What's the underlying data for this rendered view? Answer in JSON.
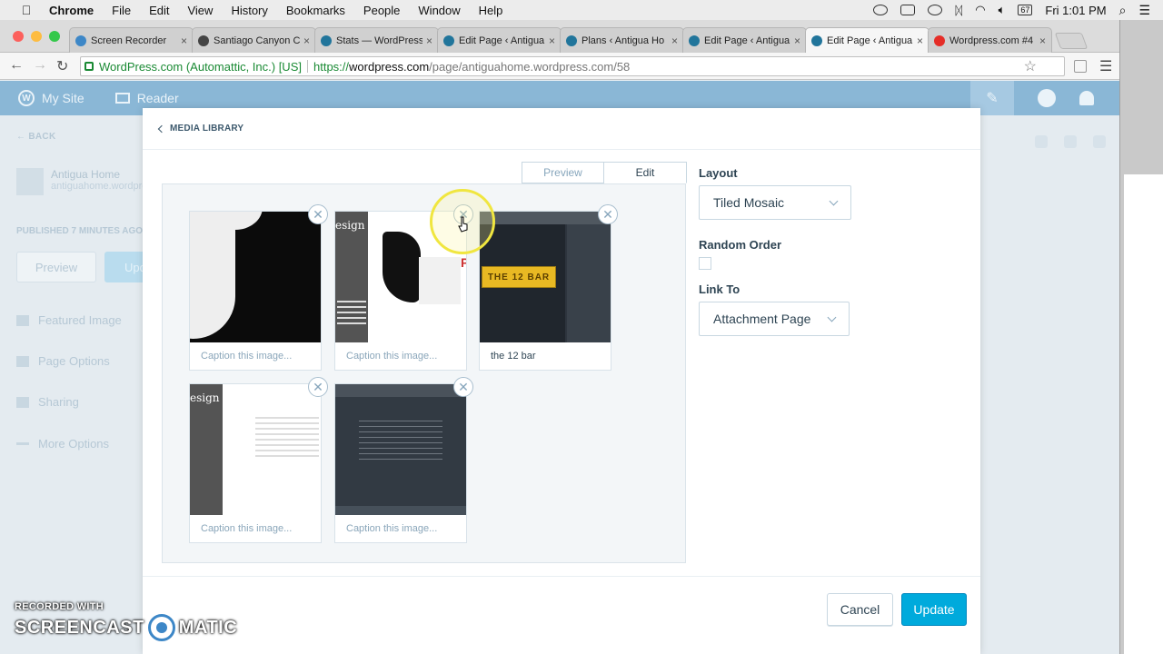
{
  "menubar": {
    "app": "Chrome",
    "items": [
      "File",
      "Edit",
      "View",
      "History",
      "Bookmarks",
      "People",
      "Window",
      "Help"
    ],
    "battery": "67",
    "clock": "Fri 1:01 PM"
  },
  "tabs": [
    {
      "label": "Screen Recorder",
      "icon": "screencast-icon",
      "color": "#3d87c7"
    },
    {
      "label": "Santiago Canyon C",
      "icon": "plane-icon",
      "color": "#444444"
    },
    {
      "label": "Stats — WordPress",
      "icon": "wordpress-icon",
      "color": "#21759b"
    },
    {
      "label": "Edit Page ‹ Antigua",
      "icon": "wordpress-icon",
      "color": "#21759b"
    },
    {
      "label": "Plans ‹ Antigua Ho",
      "icon": "wordpress-icon",
      "color": "#21759b"
    },
    {
      "label": "Edit Page ‹ Antigua",
      "icon": "wordpress-icon",
      "color": "#21759b"
    },
    {
      "label": "Edit Page ‹ Antigua",
      "icon": "wordpress-icon",
      "color": "#21759b",
      "active": true
    },
    {
      "label": "Wordpress.com #4",
      "icon": "youtube-icon",
      "color": "#e52d27"
    }
  ],
  "address": {
    "ev_label": "WordPress.com (Automattic, Inc.) [US]",
    "protocol": "https://",
    "host": "wordpress.com",
    "path": "/page/antiguahome.wordpress.com/58"
  },
  "masterbar": {
    "my_site": "My Site",
    "reader": "Reader"
  },
  "background_sidebar": {
    "back": "BACK",
    "site_name": "Antigua Home",
    "site_url": "antiguahome.wordpress.com",
    "status": "PUBLISHED 7 MINUTES AGO",
    "preview": "Preview",
    "update": "Update",
    "nav": [
      "Featured Image",
      "Page Options",
      "Sharing",
      "More Options"
    ]
  },
  "modal": {
    "back_label": "MEDIA LIBRARY",
    "view_tabs": [
      "Preview",
      "Edit"
    ],
    "active_tab": "Edit",
    "images": [
      {
        "caption": "",
        "placeholder": "Caption this image...",
        "art_text": ""
      },
      {
        "caption": "",
        "placeholder": "Caption this image...",
        "art_text": "esign"
      },
      {
        "caption": "the 12 bar",
        "placeholder": "Caption this image...",
        "art_text": "THE 12 BAR"
      },
      {
        "caption": "",
        "placeholder": "Caption this image...",
        "art_text": "esign"
      },
      {
        "caption": "",
        "placeholder": "Caption this image...",
        "art_text": ""
      }
    ],
    "settings": {
      "layout_label": "Layout",
      "layout_value": "Tiled Mosaic",
      "random_label": "Random Order",
      "random_checked": false,
      "link_label": "Link To",
      "link_value": "Attachment Page"
    },
    "cancel": "Cancel",
    "update": "Update",
    "accent": "#00aadc"
  },
  "watermark": {
    "line1": "RECORDED WITH",
    "line2a": "SCREENCAST",
    "line2b": "MATIC"
  }
}
